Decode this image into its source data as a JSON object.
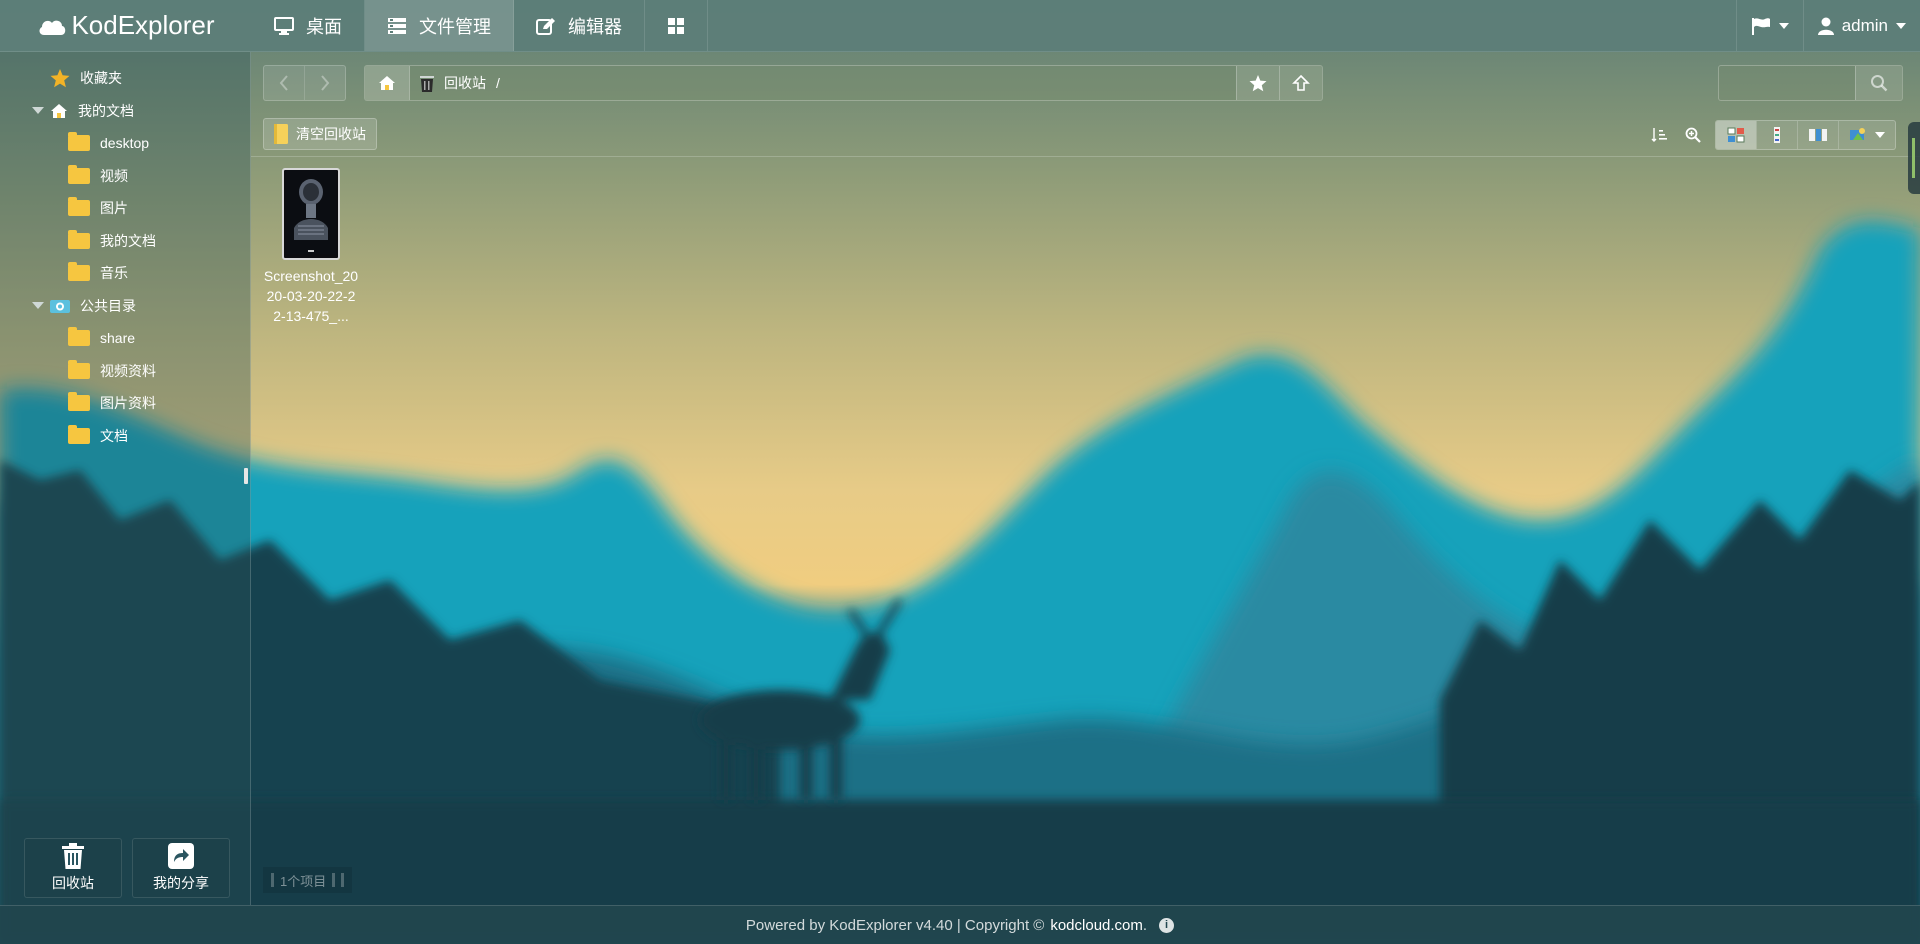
{
  "app": {
    "brand": "KodExplorer",
    "accent_color": "#5c7e78"
  },
  "topnav": {
    "items": [
      {
        "label": "桌面",
        "icon": "desktop-icon"
      },
      {
        "label": "文件管理",
        "icon": "file-manager-icon",
        "active": true
      },
      {
        "label": "编辑器",
        "icon": "editor-icon"
      },
      {
        "label": "",
        "icon": "apps-grid-icon"
      }
    ],
    "user": "admin"
  },
  "sidebar": {
    "favorites_label": "收藏夹",
    "my_docs": {
      "label": "我的文档",
      "children": [
        "desktop",
        "视频",
        "图片",
        "我的文档",
        "音乐"
      ]
    },
    "public": {
      "label": "公共目录",
      "children": [
        "share",
        "视频资料",
        "图片资料",
        "文档"
      ]
    },
    "dock": {
      "recycle_label": "回收站",
      "share_label": "我的分享"
    }
  },
  "address": {
    "location": "回收站",
    "separator": "/"
  },
  "search": {
    "placeholder": "",
    "value": ""
  },
  "toolbar": {
    "clear_recycle_label": "清空回收站"
  },
  "files": [
    {
      "name": "Screenshot_2020-03-20-22-22-13-475_..."
    }
  ],
  "status": {
    "count_label": "1个项目"
  },
  "footer": {
    "prefix": "Powered by KodExplorer v4.40 | Copyright ©",
    "link": "kodcloud.com",
    "suffix": "."
  },
  "colors": {
    "folder": "#f6c640",
    "footer_bg": "#21464e"
  }
}
